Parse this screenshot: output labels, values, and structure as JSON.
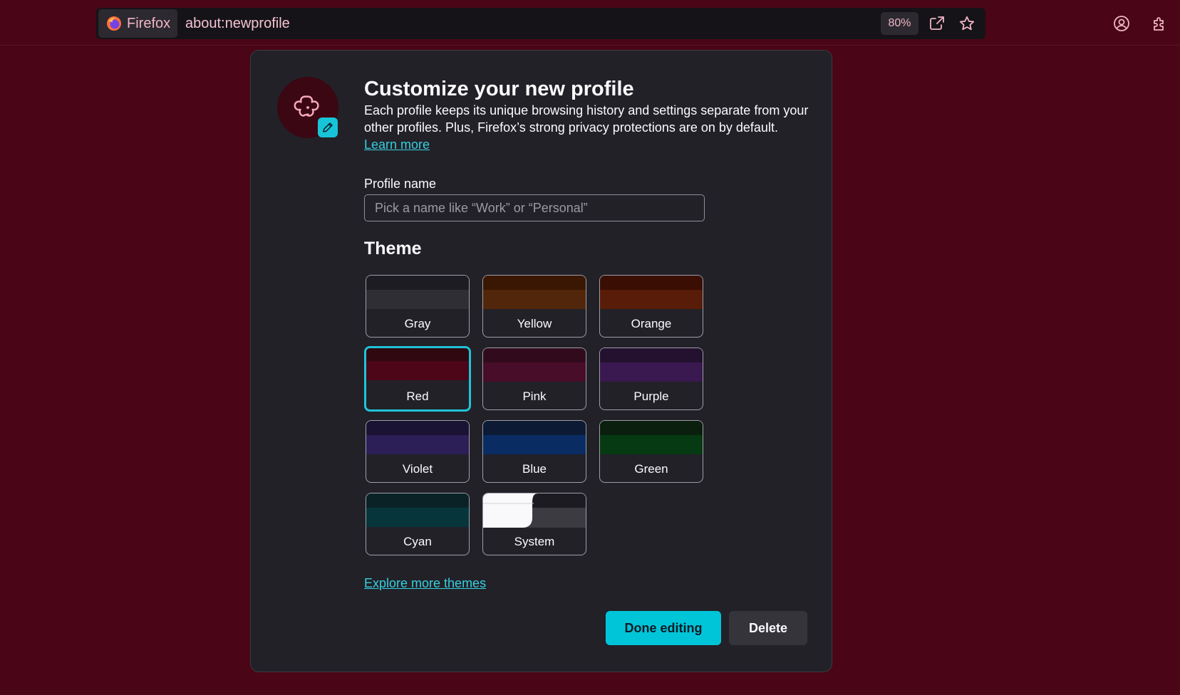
{
  "toolbar": {
    "identity_label": "Firefox",
    "url": "about:newprofile",
    "zoom": "80%",
    "icons": [
      "firefox-logo",
      "share-icon",
      "bookmark-star-icon",
      "account-icon",
      "extensions-icon"
    ]
  },
  "profile": {
    "avatar_icon": "flower-icon",
    "avatar_color": "#f4a9b8",
    "edit_icon": "pencil-icon",
    "title": "Customize your new profile",
    "description": "Each profile keeps its unique browsing history and settings separate from your other profiles. Plus, Firefox’s strong privacy protections are on by default.",
    "learn_more": "Learn more",
    "name_label": "Profile name",
    "name_placeholder": "Pick a name like “Work” or “Personal”",
    "name_value": "",
    "theme_heading": "Theme",
    "themes": [
      {
        "label": "Gray",
        "top": "#1d1c22",
        "bottom": "#2f2e35",
        "selected": false
      },
      {
        "label": "Yellow",
        "top": "#3a1703",
        "bottom": "#52260a",
        "selected": false
      },
      {
        "label": "Orange",
        "top": "#3b0e04",
        "bottom": "#581c08",
        "selected": false
      },
      {
        "label": "Red",
        "top": "#2f0810",
        "bottom": "#4c0618",
        "selected": true
      },
      {
        "label": "Pink",
        "top": "#310b1c",
        "bottom": "#480d29",
        "selected": false
      },
      {
        "label": "Purple",
        "top": "#24102f",
        "bottom": "#3a1850",
        "selected": false
      },
      {
        "label": "Violet",
        "top": "#1b1334",
        "bottom": "#2c1e57",
        "selected": false
      },
      {
        "label": "Blue",
        "top": "#0c1a33",
        "bottom": "#092c63",
        "selected": false
      },
      {
        "label": "Green",
        "top": "#0a1f0d",
        "bottom": "#063a12",
        "selected": false
      },
      {
        "label": "Cyan",
        "top": "#0a2226",
        "bottom": "#06363c",
        "selected": false
      },
      {
        "label": "System",
        "top": "#f9f9fb",
        "bottom": "#3c3b42",
        "selected": false
      }
    ],
    "explore_link": "Explore more themes",
    "done_label": "Done editing",
    "delete_label": "Delete"
  }
}
